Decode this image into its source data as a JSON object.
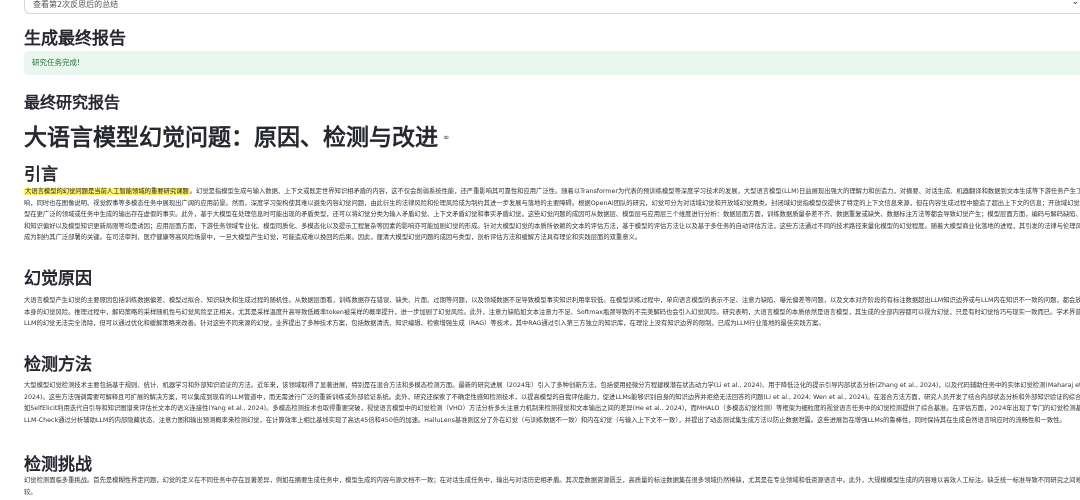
{
  "topbar": {
    "select_value": "查看第2次反思后的总结",
    "chevron_icon": "chevron-down-icon"
  },
  "header": {
    "generate_title": "生成最终报告",
    "success_message": "研究任务完成!",
    "final_report_title": "最终研究报告"
  },
  "doc": {
    "title": "大语言模型幻觉问题：原因、检测与改进",
    "title_icon": "link-icon",
    "intro": {
      "heading": "引言",
      "highlight": "大语言模型的幻觉问题是当前人工智能领域的重要研究课题",
      "text": "。幻觉是指模型生成与输入数据、上下文或既定世界知识相矛盾的内容，这不仅会削弱系统性能，还严重影响其可靠性和应用广泛性。随着以Transformer为代表的预训练模型等深度学习技术的发展，大型语言模型(LLM)日益展现出强大的理解力和创造力，对摘要、对话生成、机器翻译和数据到文本生成等下游任务产生了重要影响，同时也在图像说明、视觉叙事等多模态任务中展现出广阔的应用前景。然而，深度学习架构使其难以避免内容幻觉问题，由此衍生的法律风险和伦理风险成为制约其进一步发展与落地的主要障碍。根据OpenAI团队的研究，幻觉可分为对话域幻觉和开放域幻觉两类。封闭域幻觉指模型仅提供了特定的上下文信息来源，但在内容生成过程中臆造了超出上下文的信息；开放域幻觉则指模型在更广泛的领域或任务中生成的输出存在虚假的事实。此外，基于大模型在处理信息时可能出现的矛盾类型，还可以将幻觉分类为输入矛盾幻觉、上下文矛盾幻觉和事实矛盾幻觉。这些幻觉问题的成因可从数据层、模型层与应用层三个维度进行分析：数据层面方面，训练数据质量参差不齐、数据重复或缺失、数据标注方法等都会导致幻觉产生；模型层面方面，编码与解码缺陷、预训练和知识偏好以及模型知识更新局限等均是诱因；应用层面方面，下游任务领域专业化、模型同质化、多模态化以及提示工程复杂等因素的影响亦可能加剧幻觉的形成。针对大模型幻觉的本质所依赖的文本的评估方法，基于模型的评估方法让以及基于多任务的自动评估方法，这些方法通过不同的技术路径来量化模型的幻觉程度。随着大模型商业化落地的进程，其引发的法律与伦理风险已经成为制约其广泛部署的关键。在司法审判、医疗健康等高风险场景中，一旦大模型产生幻觉，可能造成难以挽回的后果。因此，厘清大模型幻觉问题的成因与类型，剖析评估方法和缓解方法具有理论和实践层面的双重意义。"
    },
    "cause": {
      "heading": "幻觉原因",
      "text": "大语言模型产生幻觉的主要原因包括训练数据偏差、模型过拟合、知识缺失和生成过程的随机性。从数据层面看，训练数据存在错误、缺失、片面、过期等问题，以及领域数据不足导致模型事实知识利用率较低。在模型训练过程中，单向语言模型的表示不足、注意力缺陷、曝光偏差等问题，以及文本对齐阶段的有标注数据超出LLM知识边界或与LLM内在知识不一致的问题，都会放大模型本身的幻觉风险。推理过程中，解码策略的采样随机性与幻觉风险呈正相关，尤其是采样温度升高导致低概率token被采样的概率提升，进一步加剧了幻觉风险。此外，注意力缺陷如文本注意力不足、Softmax瓶颈导致的不完美解码也会引入幻觉风险。研究表明，大语言模型的本质依然是语言模型，其生成的全部内容都可以视为幻觉，只是有时幻觉恰巧与现实一致而已。学术界普遍认为LLM的幻觉无法完全消除，但可以通过优化和缓解策略来改善。针对这些不同来源的幻觉，业界提出了多种技术方案，包括数据清洗、知识编辑、检索增强生成（RAG）等技术，其中RAG通过引入第三方独立的知识库，在理论上没有知识边界的限制，已成为LLM行业落地的最佳实践方案。"
    },
    "method": {
      "heading": "检测方法",
      "text": "大型模型幻觉检测技术主要包括基于规则、统计、机器学习和外部知识验证的方法。近年来，该领域取得了显著进展，特别是在混合方法和多模态检测方面。最新的研究进展（2024年）引入了多种创新方法，包括使用经微分方程建模潜在状态动力学(Li et al., 2024)、用于降低泛化的提示引导内部状态分析(Zhang et al., 2024)，以及代码辅助任务中的实体幻觉检测(Maharaj et al., 2024)。这些方法强调需要可解释且可扩展的解决方案，可以集成到现有的LLM管道中，而无需进行广泛的重新训练或外部验证系统。此外，研究还探索了不确定性感知检测技术，以提高模型的自我评估能力，促进LLMs能够识别自身的知识边界并拒绝无法回答的问题(Li et al., 2024; Wen et al., 2024)。在混合方法方面，研究人员开发了结合内部状态分析和外部知识验证的综合框架，如SelfElicit利用迭代自引导和知识图谱来评估长文本的语义连接性(Yang et al., 2024)。多模态检测技术也取得重要突破，视觉语言模型中的幻觉检测（VHD）方法分析多头注意力机制来检测视觉和文本输出之间的差异(He et al., 2024)，而MHALO（多模态幻觉检测）等框架为细粒度的视觉语言任务中的幻觉检测提供了综合基准。在评估方面，2024年出现了专门的幻觉检测基准，如LLM-Check通过分析辅助LLM的内部隐藏状态、注意力图和输出预测概率来检测幻觉，在计算效率上相比基线实现了高达45倍和450倍的加速。HalluLens基准则区分了外在幻觉（与训练数据不一致）和内在幻觉（与输入上下文不一致），并提出了动态测试集生成方法以防止数据泄露。这些进展旨在增强LLMs的鲁棒性，同时保持其在生成自然语言响应时的流畅性和一致性。"
    },
    "challenge": {
      "heading": "检测挑战",
      "text": "幻觉检测面临多重挑战。首先是模糊性界定问题，幻觉的定义在不同任务中存在显著差异，例如在摘要生成任务中，模型生成的内容与源文档不一致；在对话生成任务中，输出与对话历史相矛盾。其次是数据资源匮乏，高质量的标注数据集在很多领域仍然稀缺，尤其是在专业领域和低资源语言中。此外，大规模模型生成的内容难以高效人工标注。缺乏统一标准导致不同研究之间难以比较。"
    }
  }
}
